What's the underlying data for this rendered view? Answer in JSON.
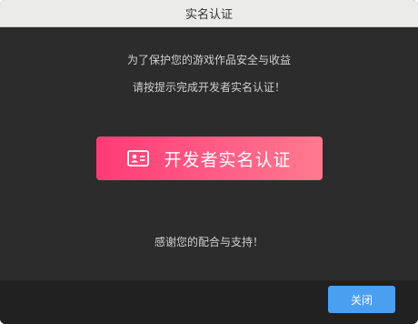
{
  "window": {
    "title": "实名认证"
  },
  "body": {
    "line1": "为了保护您的游戏作品安全与收益",
    "line2": "请按提示完成开发者实名认证！",
    "cta_label": "开发者实名认证",
    "cta_icon": "id-card-icon",
    "thanks": "感谢您的配合与支持！"
  },
  "footer": {
    "close_label": "关闭"
  },
  "colors": {
    "cta_gradient_start": "#ff3b77",
    "cta_gradient_end": "#ff7a8f",
    "close_button": "#4a9ff0",
    "background": "#2c2c2c"
  }
}
